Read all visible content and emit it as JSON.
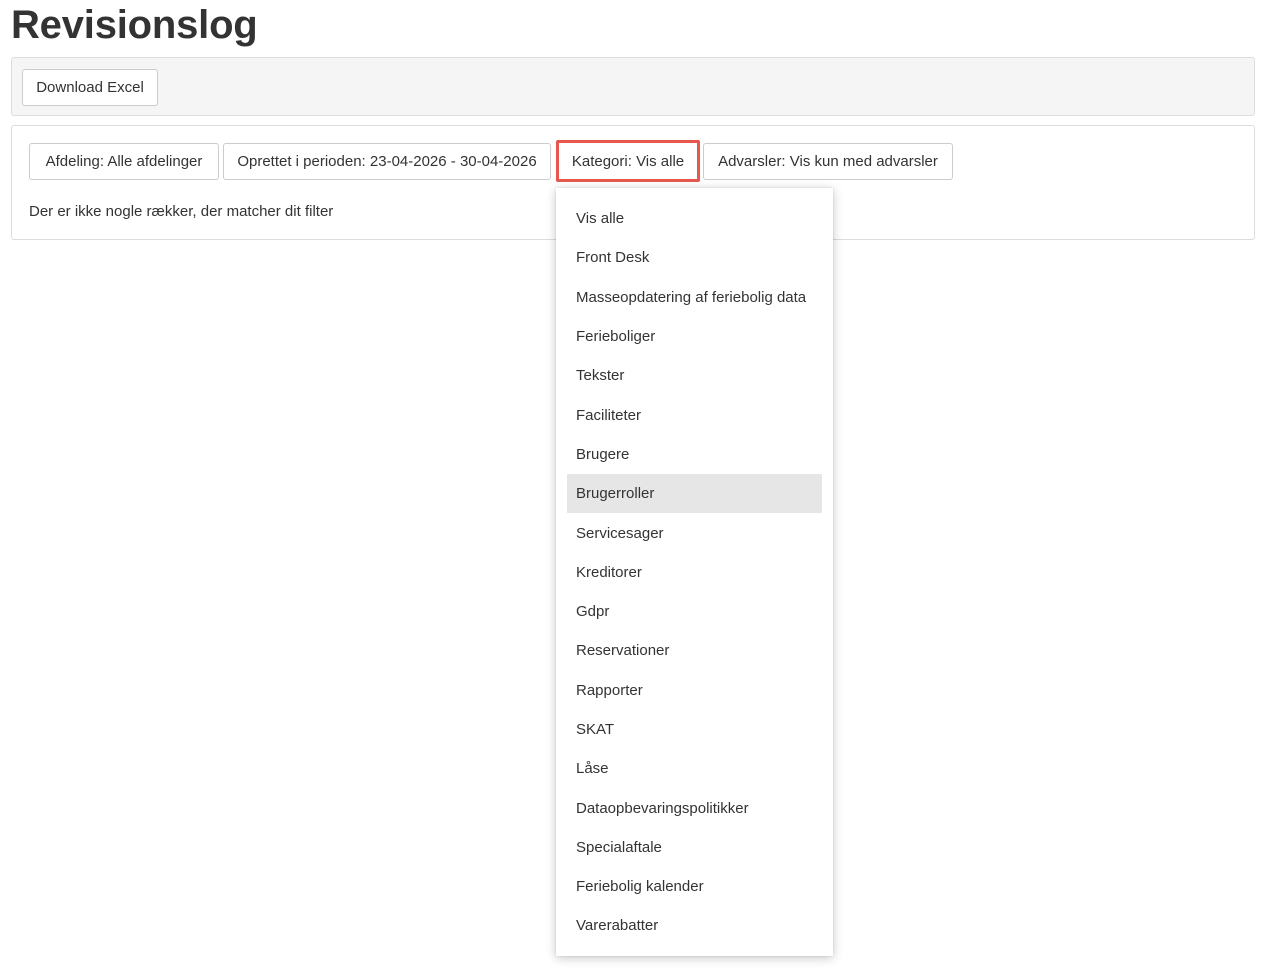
{
  "page": {
    "title": "Revisionslog"
  },
  "toolbar": {
    "download_label": "Download Excel"
  },
  "filters": {
    "afdeling_label": "Afdeling: Alle afdelinger",
    "periode_label": "Oprettet i perioden: 23-04-2026 - 30-04-2026",
    "kategori_label": "Kategori: Vis alle",
    "advarsler_label": "Advarsler: Vis kun med advarsler",
    "highlight_color": "#e8574d"
  },
  "results": {
    "empty_message": "Der er ikke nogle rækker, der matcher dit filter"
  },
  "kategori_dropdown": {
    "hovered_item": "Brugerroller",
    "items": [
      "Vis alle",
      "Front Desk",
      "Masseopdatering af feriebolig data",
      "Ferieboliger",
      "Tekster",
      "Faciliteter",
      "Brugere",
      "Brugerroller",
      "Servicesager",
      "Kreditorer",
      "Gdpr",
      "Reservationer",
      "Rapporter",
      "SKAT",
      "Låse",
      "Dataopbevaringspolitikker",
      "Specialaftale",
      "Feriebolig kalender",
      "Varerabatter"
    ]
  }
}
